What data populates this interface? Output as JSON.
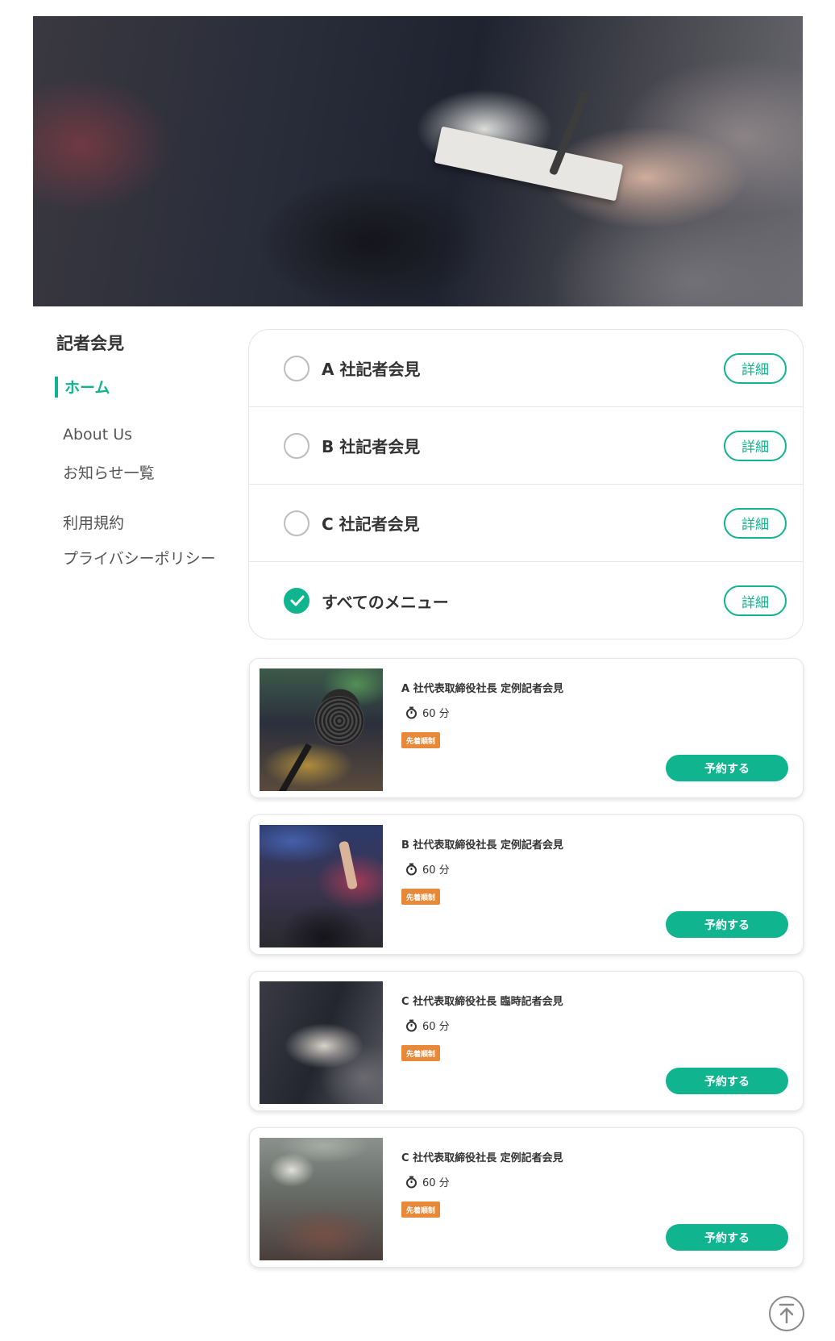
{
  "sidebar": {
    "title": "記者会見",
    "home": "ホーム",
    "links": [
      "About Us",
      "お知らせ一覧",
      "利用規約",
      "プライバシーポリシー"
    ]
  },
  "menu": {
    "items": [
      {
        "label": "A 社記者会見",
        "checked": false,
        "detail_label": "詳細"
      },
      {
        "label": "B 社記者会見",
        "checked": false,
        "detail_label": "詳細"
      },
      {
        "label": "C 社記者会見",
        "checked": false,
        "detail_label": "詳細"
      },
      {
        "label": "すべてのメニュー",
        "checked": true,
        "detail_label": "詳細"
      }
    ]
  },
  "events": [
    {
      "title": "A 社代表取締役社長 定例記者会見",
      "duration": "60 分",
      "badge": "先着順制",
      "button": "予約する"
    },
    {
      "title": "B 社代表取締役社長 定例記者会見",
      "duration": "60 分",
      "badge": "先着順制",
      "button": "予約する"
    },
    {
      "title": "C 社代表取締役社長 臨時記者会見",
      "duration": "60 分",
      "badge": "先着順制",
      "button": "予約する"
    },
    {
      "title": "C 社代表取締役社長 定例記者会見",
      "duration": "60 分",
      "badge": "先着順制",
      "button": "予約する"
    }
  ],
  "colors": {
    "accent": "#10b48f",
    "badge": "#e8893a"
  },
  "icons": {
    "timer": "stopwatch-icon",
    "check": "check-icon",
    "top": "arrow-up-to-top-icon"
  }
}
